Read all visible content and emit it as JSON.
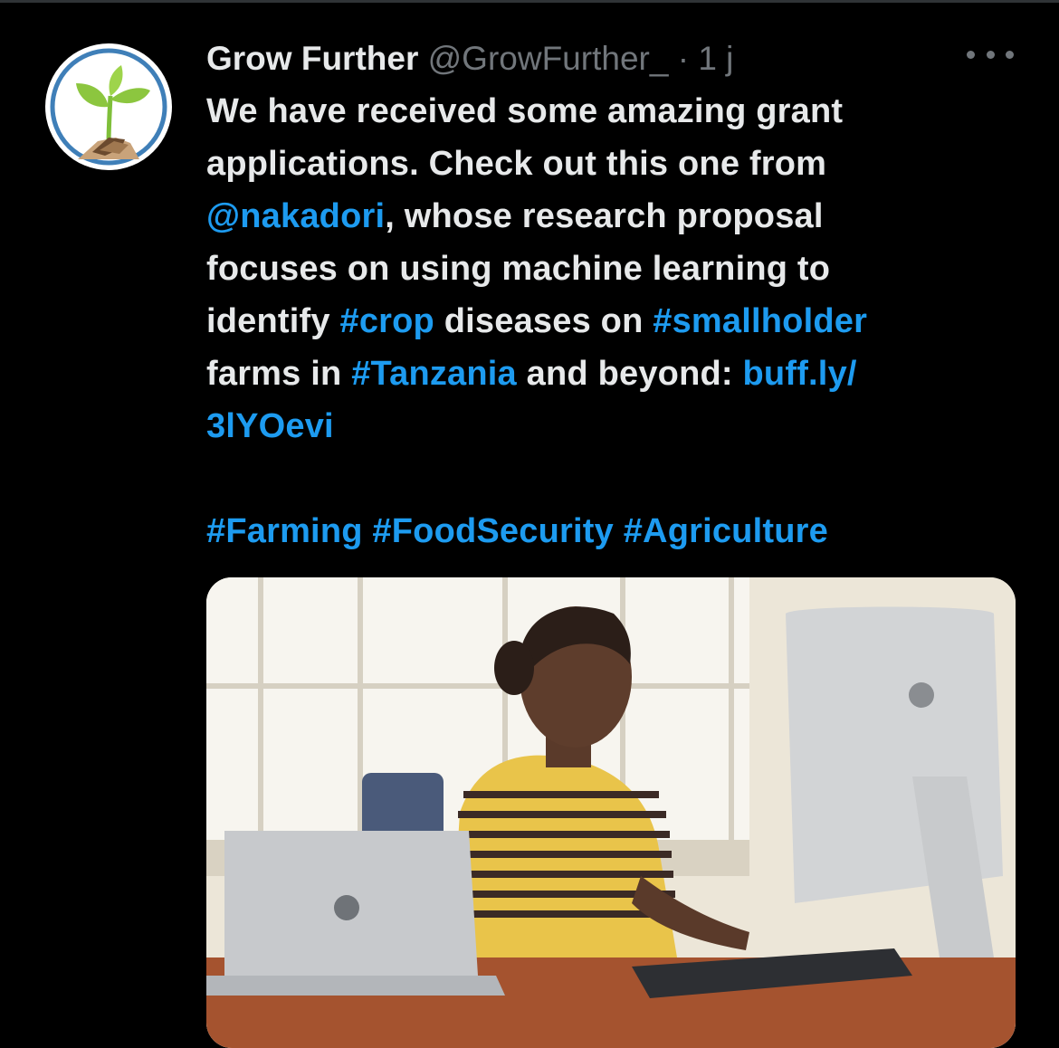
{
  "tweet": {
    "display_name": "Grow Further",
    "handle": "@GrowFurther_",
    "separator": "·",
    "time": "1 j",
    "more_icon": "ellipsis-icon",
    "lines": [
      [
        {
          "t": "We have received some amazing grant",
          "link": false
        }
      ],
      [
        {
          "t": "applications. Check out this one from",
          "link": false
        }
      ],
      [
        {
          "t": "@nakadori",
          "link": true
        },
        {
          "t": ", whose research proposal",
          "link": false
        }
      ],
      [
        {
          "t": "focuses on using machine learning to",
          "link": false
        }
      ],
      [
        {
          "t": "identify ",
          "link": false
        },
        {
          "t": "#crop",
          "link": true
        },
        {
          "t": " diseases on ",
          "link": false
        },
        {
          "t": "#smallholder",
          "link": true
        }
      ],
      [
        {
          "t": "farms in ",
          "link": false
        },
        {
          "t": "#Tanzania",
          "link": true
        },
        {
          "t": " and beyond: ",
          "link": false
        },
        {
          "t": "buff.ly/",
          "link": true
        }
      ],
      [
        {
          "t": "3lYOevi",
          "link": true
        }
      ],
      [],
      [
        {
          "t": "#Farming",
          "link": true
        },
        {
          "t": " ",
          "link": false
        },
        {
          "t": "#FoodSecurity",
          "link": true
        },
        {
          "t": " ",
          "link": false
        },
        {
          "t": "#Agriculture",
          "link": true
        }
      ]
    ]
  },
  "colors": {
    "background": "#000000",
    "text": "#e7e9ea",
    "muted": "#71767b",
    "link": "#1d9bf0"
  },
  "avatar": {
    "icon": "grow-further-logo-icon"
  },
  "media": {
    "icon": "photo-woman-at-computer"
  }
}
